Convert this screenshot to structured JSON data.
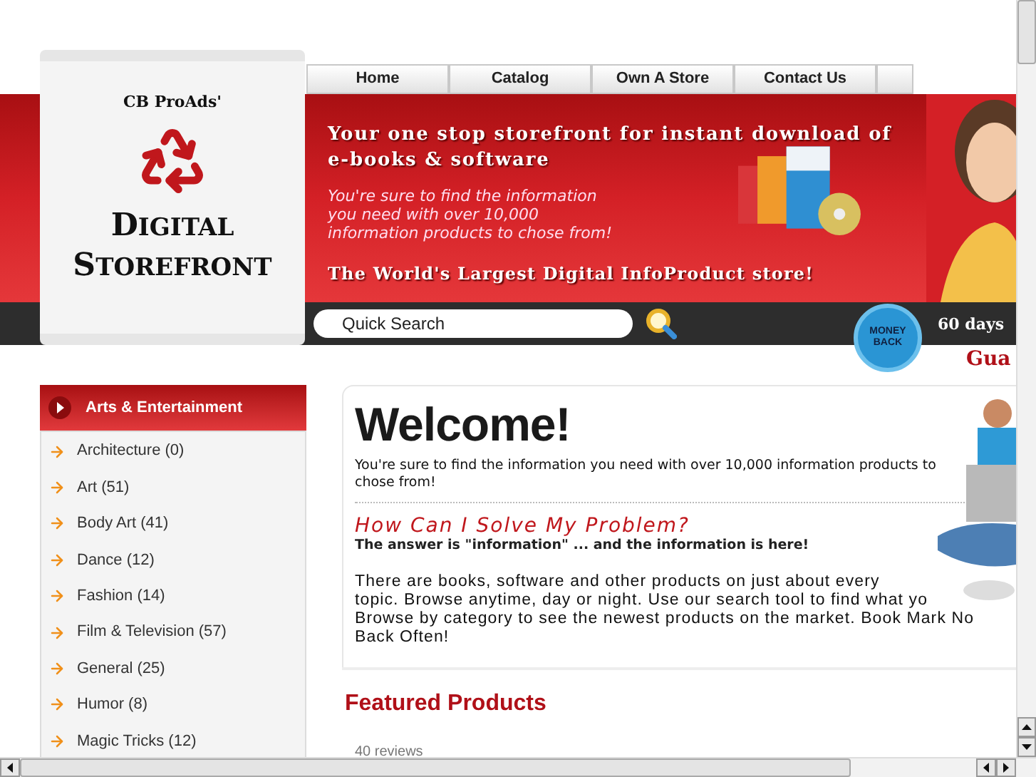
{
  "logo": {
    "brand": "CB ProAds'",
    "title_line_1": "DIGITAL",
    "title_line_2": "STOREFRONT"
  },
  "nav": [
    "Home",
    "Catalog",
    "Own A Store",
    "Contact Us"
  ],
  "banner": {
    "headline": "Your one stop storefront for instant download of e-books & software",
    "subtext": "You're sure to find the information you need with over 10,000 information products to chose from!",
    "tagline": "The World's Largest Digital InfoProduct store!"
  },
  "search": {
    "placeholder": "Quick Search"
  },
  "guarantee": {
    "badge_line_1": "MONEY",
    "badge_line_2": "BACK",
    "days": "60 days",
    "label": "Gua"
  },
  "sidebar": {
    "title": "Arts & Entertainment",
    "items": [
      "Architecture (0)",
      "Art (51)",
      "Body Art (41)",
      "Dance (12)",
      "Fashion (14)",
      "Film & Television (57)",
      "General (25)",
      "Humor (8)",
      "Magic Tricks (12)"
    ]
  },
  "main": {
    "title": "Welcome!",
    "intro": "You're sure to find the information you need with over 10,000 information products to chose from!",
    "heading": "How Can I Solve My Problem?",
    "subheading": "The answer is \"information\" ... and the information is here!",
    "body_lines": [
      "There are books, software and other products on just about every",
      "topic. Browse anytime, day or night. Use our search tool to find what yo",
      "Browse by category to see the newest products on the market. Book Mark No",
      "Back Often!"
    ],
    "featured_title": "Featured Products",
    "reviews": "40 reviews"
  }
}
